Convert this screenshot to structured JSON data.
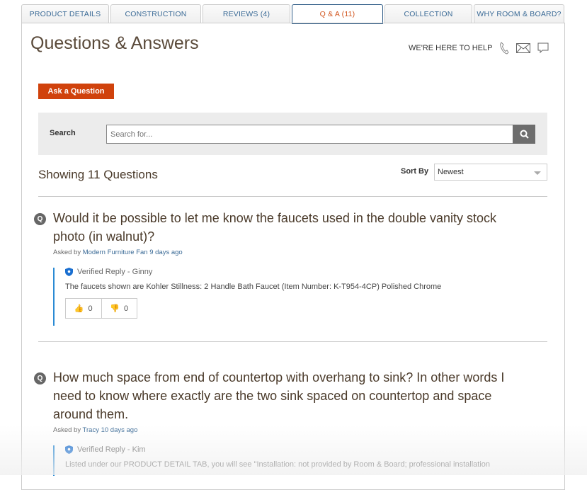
{
  "tabs": [
    {
      "label": "PRODUCT DETAILS"
    },
    {
      "label": "CONSTRUCTION"
    },
    {
      "label": "REVIEWS (4)"
    },
    {
      "label": "Q & A (11)",
      "active": true
    },
    {
      "label": "COLLECTION"
    },
    {
      "label": "WHY ROOM & BOARD?"
    }
  ],
  "header": {
    "title": "Questions & Answers",
    "help": "WE'RE HERE TO HELP"
  },
  "ask_label": "Ask a Question",
  "search": {
    "label": "Search",
    "placeholder": "Search for..."
  },
  "showing": "Showing 11 Questions",
  "sort": {
    "label": "Sort By",
    "value": "Newest"
  },
  "colors": {
    "accent": "#d0420c",
    "link": "#3a6a96",
    "reply_border": "#2a8ad4"
  },
  "questions": [
    {
      "text": "Would it be possible to let me know the faucets used in the double vanity stock photo (in walnut)?",
      "asked_by": "Asked by",
      "author": "Modern Furniture Fan",
      "age": "9 days ago",
      "reply": {
        "title": "Verified Reply - Ginny",
        "text": "The faucets shown are Kohler Stillness: 2 Handle Bath Faucet (Item Number: K-T954-4CP) Polished Chrome",
        "up": "0",
        "down": "0"
      }
    },
    {
      "text": "How much space from end of countertop with overhang to sink? In other words I need to know where exactly are the two sink spaced on countertop and space around them.",
      "asked_by": "Asked by",
      "author": "Tracy",
      "age": "10 days ago",
      "reply": {
        "title": "Verified Reply - Kim",
        "text": "Listed under our PRODUCT DETAIL TAB, you will see \"Installation: not provided by Room & Board; professional installation"
      }
    }
  ]
}
